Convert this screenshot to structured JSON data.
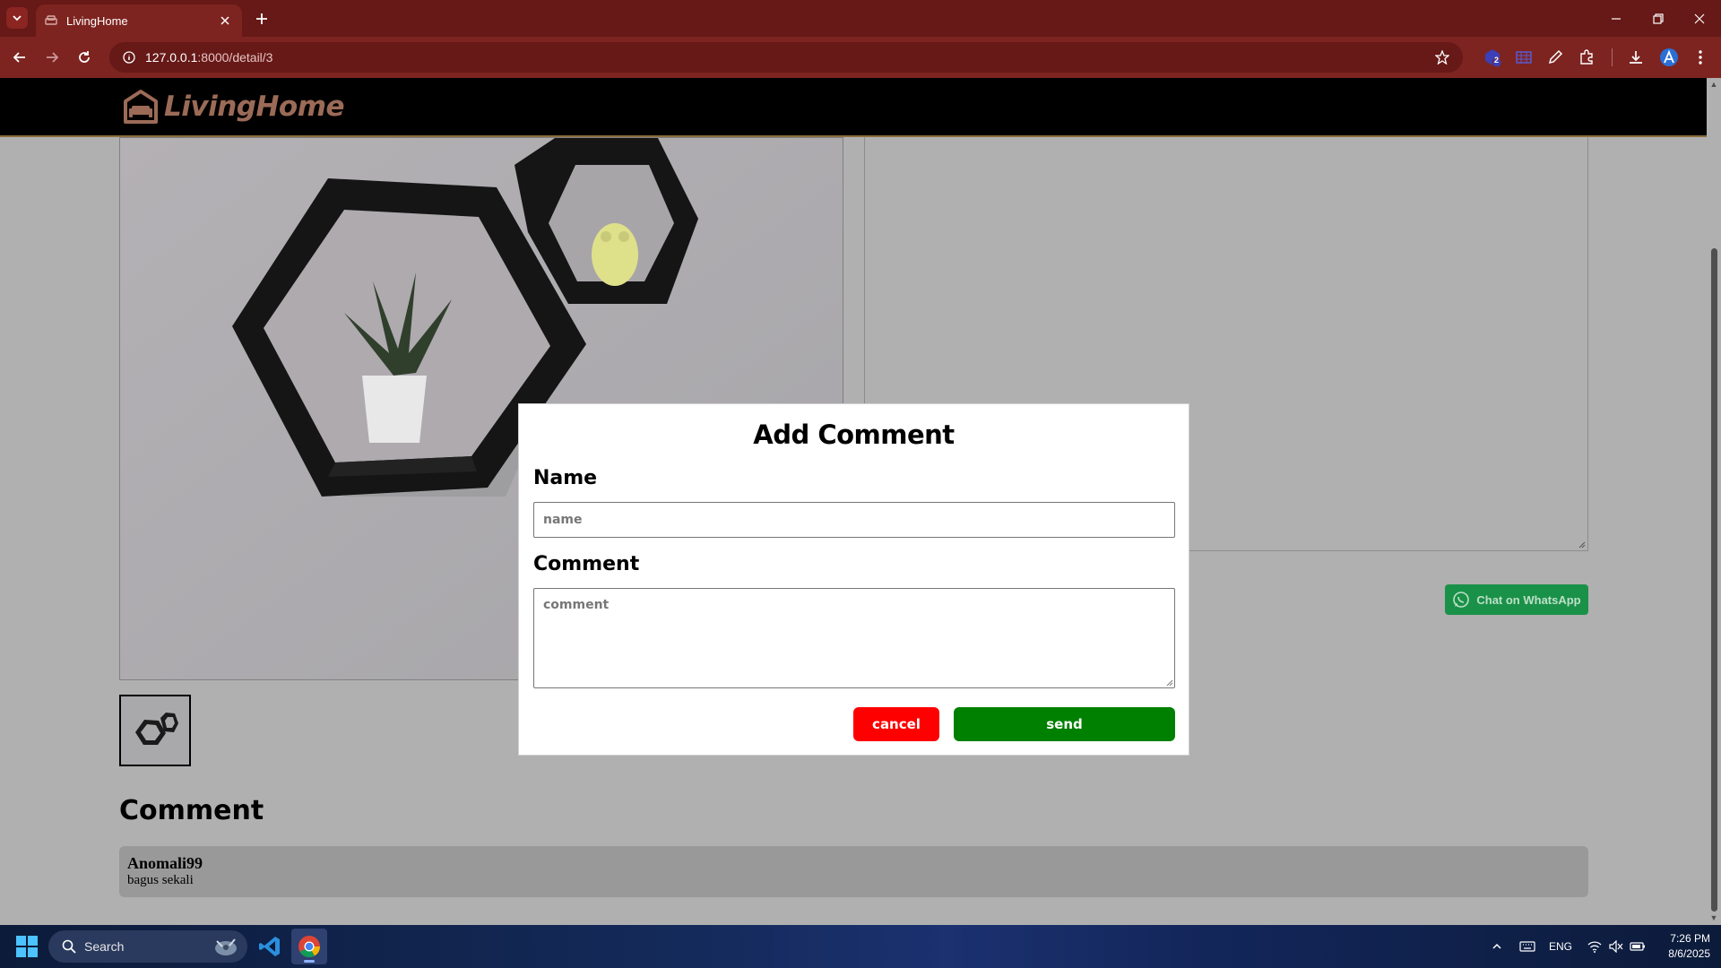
{
  "browser": {
    "tab_title": "LivingHome",
    "url_host": "127.0.0.1",
    "url_path": ":8000/detail/3",
    "extension_badge": "2"
  },
  "site": {
    "brand": "LivingHome"
  },
  "product": {
    "whatsapp_label": "Chat on WhatsApp"
  },
  "comments": {
    "heading": "Comment",
    "items": [
      {
        "author": "Anomali99",
        "text": "bagus sekali"
      }
    ]
  },
  "modal": {
    "title": "Add Comment",
    "name_label": "Name",
    "name_placeholder": "name",
    "name_value": "",
    "comment_label": "Comment",
    "comment_placeholder": "comment",
    "comment_value": "",
    "cancel_label": "cancel",
    "send_label": "send"
  },
  "taskbar": {
    "search_label": "Search",
    "language": "ENG",
    "time": "7:26 PM",
    "date": "8/6/2025"
  },
  "colors": {
    "browser_frame": "#661917",
    "toolbar": "#7d2420",
    "cancel": "#ff0000",
    "send": "#008000",
    "whatsapp": "#1a9148",
    "overlay": "#b0b0b0"
  }
}
